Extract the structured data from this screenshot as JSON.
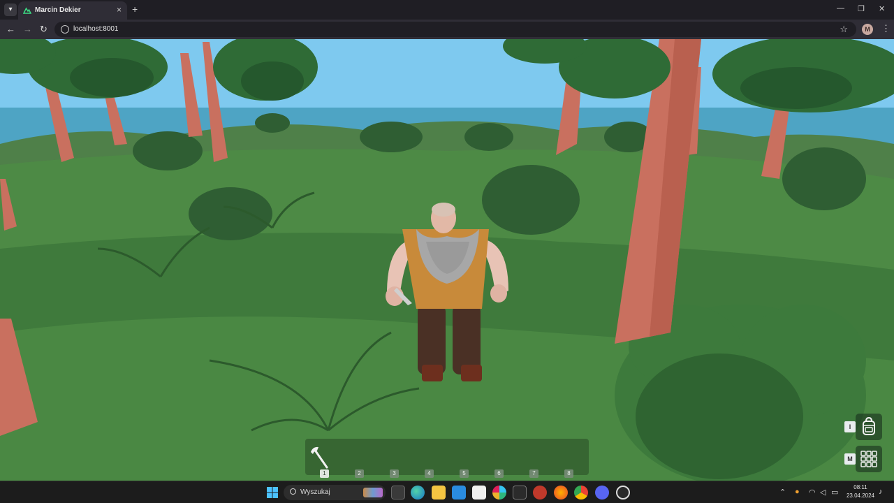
{
  "browser": {
    "tab_menu_icon": "chevron-down-icon",
    "tab_title": "Marcin Dekier",
    "tab_close": "×",
    "new_tab": "+",
    "back": "←",
    "forward": "→",
    "reload": "↻",
    "url": "localhost:8001",
    "bookmark": "☆",
    "profile_initial": "M",
    "menu": "⋮",
    "minimize": "—",
    "restore": "❐",
    "close": "✕"
  },
  "game": {
    "hotbar": {
      "slots": [
        "1",
        "2",
        "3",
        "4",
        "5",
        "6",
        "7",
        "8"
      ],
      "active_slot": "1",
      "equipped_item_icon": "axe-icon"
    },
    "inventory": {
      "key": "I",
      "icon": "backpack-icon"
    },
    "map": {
      "key": "M",
      "icon": "grid-icon"
    }
  },
  "taskbar": {
    "search_label": "Wyszukaj",
    "time": "08:11",
    "date": "23.04.2024",
    "apps": [
      "windows-start-icon",
      "task-view-icon",
      "edge-icon",
      "file-explorer-icon",
      "vscode-icon",
      "notion-icon",
      "slack-icon",
      "terminal-icon",
      "app-red-icon",
      "firefox-icon",
      "chrome-icon",
      "discord-icon",
      "obs-icon"
    ]
  },
  "colors": {
    "sky": "#7ec9ef",
    "sea": "#4ea4c4",
    "grass": "#4d8a45",
    "trunk": "#c9705f",
    "tunic": "#c88a3a",
    "pants": "#4a3025"
  }
}
